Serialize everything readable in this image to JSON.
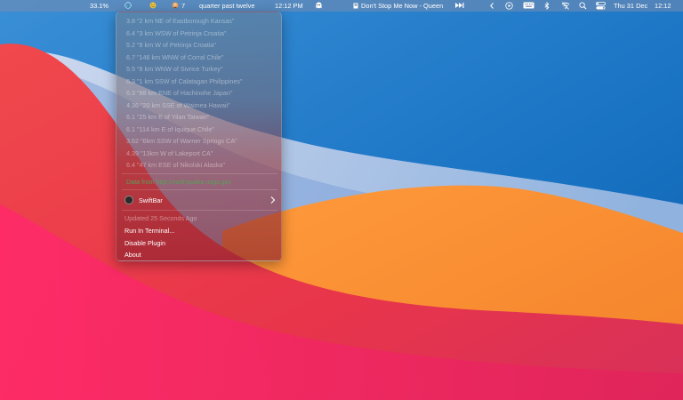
{
  "menubar": {
    "battery_percent": "33.1%",
    "count": "7",
    "clock_words": "quarter past twelve",
    "time": "12:12 PM",
    "now_playing": "Don't Stop Me Now - Queen",
    "date": "Thu 31 Dec",
    "clock": "12:12",
    "icons": [
      "globe-icon",
      "emoji-icon",
      "emoji-person-icon",
      "ghost-icon",
      "music-note-icon",
      "skip-icon",
      "chevron-left-icon",
      "play-circle-icon",
      "keyboard-icon",
      "bluetooth-icon",
      "wifi-off-icon",
      "search-icon",
      "control-center-icon"
    ]
  },
  "menu": {
    "quakes": [
      "3.8 \"2 km NE of Eastborough Kansas\"",
      "6.4 \"3 km WSW of Petrinja Croatia\"",
      "5.2 \"8 km W of Petrinja Croatia\"",
      "6.7 \"146 km WNW of Corral Chile\"",
      "5.5 \"8 km WNW of Sivrice Turkey\"",
      "6.3 \"1 km SSW of Calatagan Philippines\"",
      "6.3 \"98 km ENE of Hachinohe Japan\"",
      "4.36 \"20 km SSE of Waimea Hawaii\"",
      "6.1 \"25 km E of Yilan Taiwan\"",
      "6.1 \"114 km E of Iquique Chile\"",
      "3.62 \"6km SSW of Warner Springs CA\"",
      "4.39 \"13km W of Lakeport CA\"",
      "6.4 \"47 km ESE of Nikolski Alaska\""
    ],
    "data_source": "Data from http://earthquake.usgs.gov",
    "app_name": "SwiftBar",
    "updated": "Updated 25 Seconds Ago",
    "run_in_terminal": "Run In Terminal...",
    "disable_plugin": "Disable Plugin",
    "about": "About"
  }
}
